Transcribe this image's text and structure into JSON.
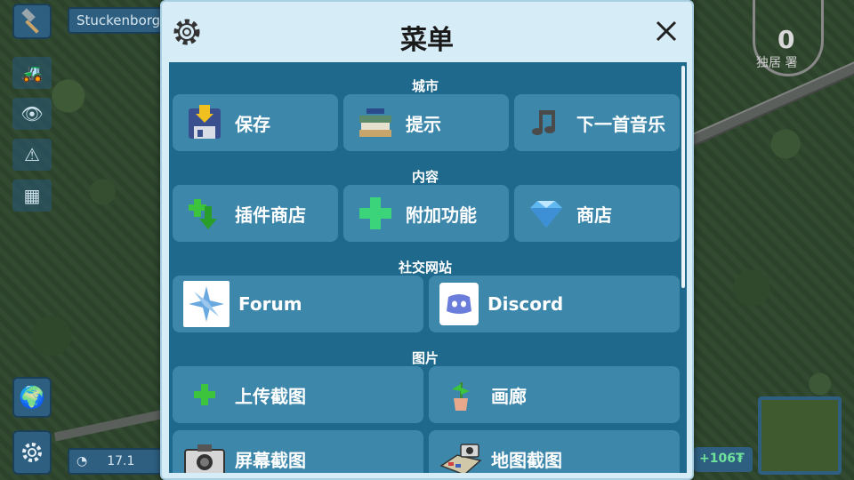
{
  "game": {
    "city_name": "Stuckenborg",
    "gauge_value": "0",
    "gauge_label": "独居  署",
    "money": "+106₮",
    "date": "17.1"
  },
  "dialog": {
    "title": "菜单",
    "sections": {
      "city": {
        "label": "城市",
        "buttons": [
          "保存",
          "提示",
          "下一首音乐"
        ]
      },
      "content": {
        "label": "内容",
        "buttons": [
          "插件商店",
          "附加功能",
          "商店"
        ]
      },
      "social": {
        "label": "社交网站",
        "buttons": [
          "Forum",
          "Discord"
        ]
      },
      "images": {
        "label": "图片",
        "buttons": [
          "上传截图",
          "画廊",
          "屏幕截图",
          "地图截图"
        ]
      }
    }
  },
  "icons": {
    "settings": "gear-icon",
    "close": "close-icon",
    "save": "floppy-icon",
    "tips": "books-icon",
    "music": "music-note-icon",
    "plugin_store": "download-plus-icon",
    "addons": "plus-icon",
    "shop": "diamond-icon",
    "forum": "snowflake-icon",
    "discord": "discord-icon",
    "upload": "plus-icon",
    "gallery": "plant-icon",
    "screenshot": "camera-icon",
    "map_screenshot": "map-camera-icon"
  },
  "colors": {
    "dialog_bg": "#d6ecf6",
    "body_bg": "#1f6a8c",
    "button_bg": "#3d87aa",
    "money_green": "#6fe39a"
  }
}
